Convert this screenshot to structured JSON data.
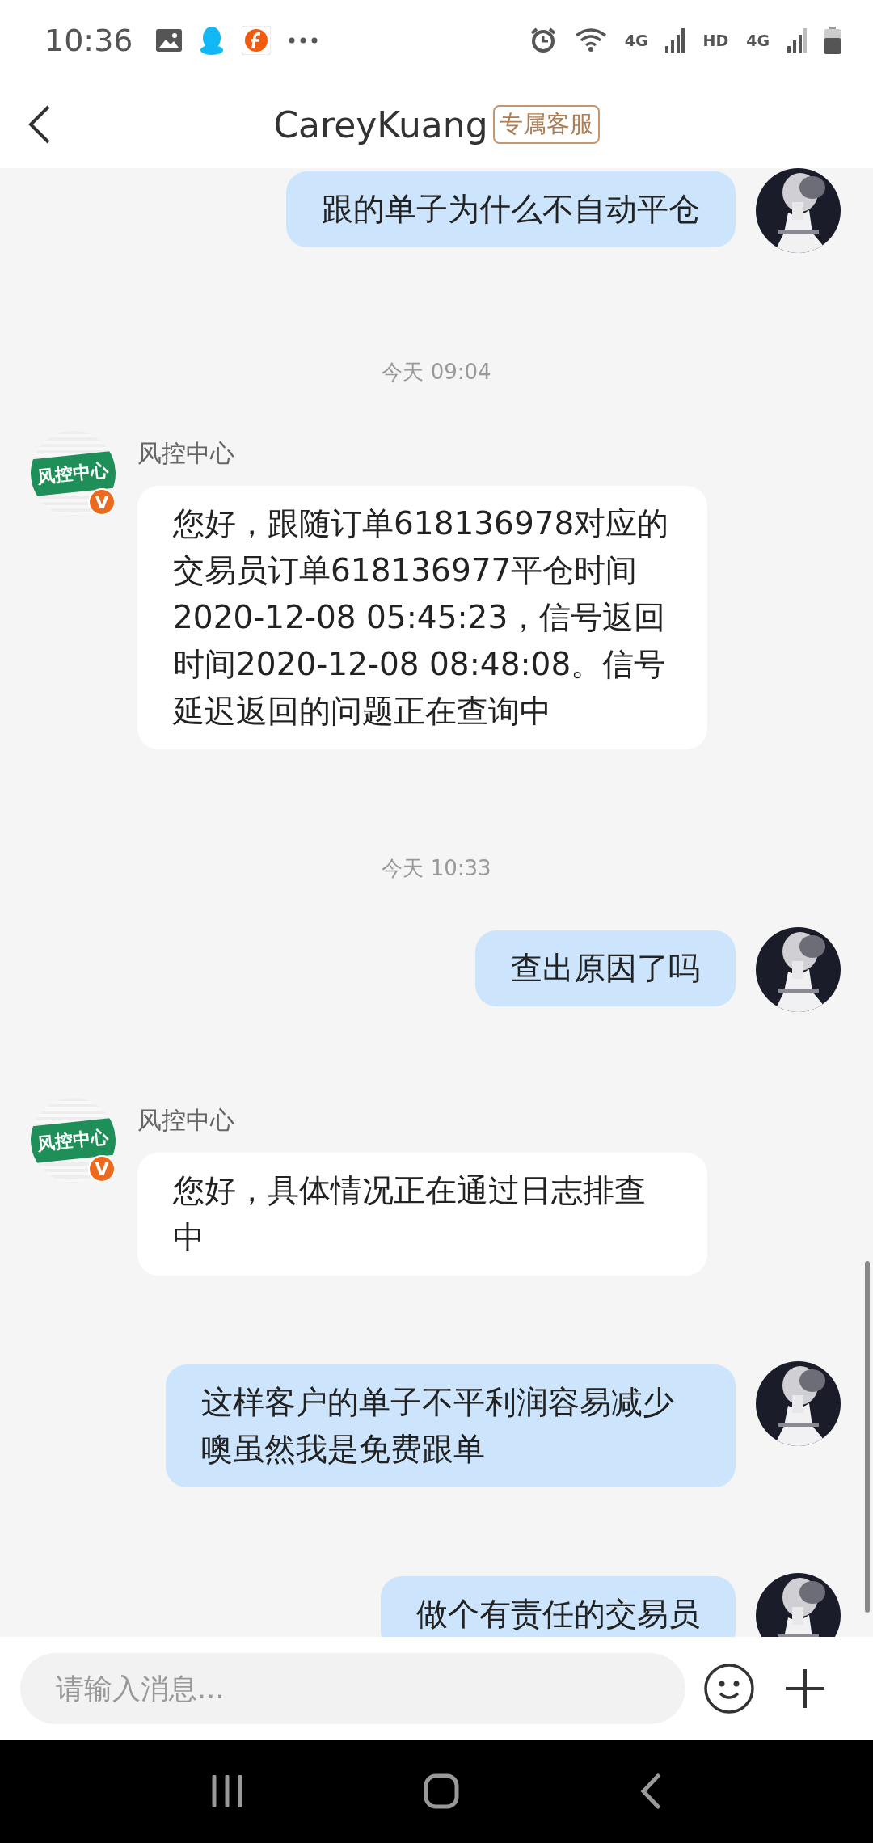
{
  "status_bar": {
    "time": "10:36",
    "indicators": [
      "4G",
      "HD",
      "4G"
    ]
  },
  "header": {
    "title": "CareyKuang",
    "badge": "专属客服"
  },
  "messages": [
    {
      "kind": "outgoing",
      "text": "跟的单子为什么不自动平仓"
    },
    {
      "kind": "time",
      "text": "今天 09:04"
    },
    {
      "kind": "incoming",
      "sender": "风控中心",
      "avatar_text": "风控中心",
      "verified_badge": "V",
      "text": "您好，跟随订单618136978对应的交易员订单618136977平仓时间2020-12-08 05:45:23，信号返回时间2020-12-08 08:48:08。信号延迟返回的问题正在查询中"
    },
    {
      "kind": "time",
      "text": "今天 10:33"
    },
    {
      "kind": "outgoing",
      "text": "查出原因了吗"
    },
    {
      "kind": "incoming",
      "sender": "风控中心",
      "avatar_text": "风控中心",
      "verified_badge": "V",
      "text": "您好，具体情况正在通过日志排查中"
    },
    {
      "kind": "outgoing",
      "text": "这样客户的单子不平利润容易减少噢虽然我是免费跟单"
    },
    {
      "kind": "outgoing",
      "text": "做个有责任的交易员"
    }
  ],
  "input": {
    "placeholder": "请输入消息..."
  }
}
